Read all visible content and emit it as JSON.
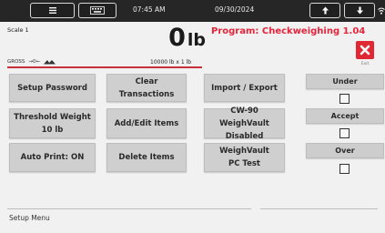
{
  "topbar": {
    "time": "07:45 AM",
    "date": "09/30/2024",
    "icons": [
      "menu-icon",
      "keyboard-icon",
      "arrow-up-icon",
      "arrow-down-icon",
      "wifi-icon"
    ]
  },
  "display": {
    "scale_name": "Scale 1",
    "weight_value": "0",
    "weight_unit": "lb",
    "gross_label": "GROSS",
    "zero_indicator": "→0←",
    "capacity": "10000 lb x 1 lb"
  },
  "program": {
    "title": "Program: Checkweighing 1.04",
    "exit_label": "Exit"
  },
  "buttons": {
    "setup_password": "Setup Password",
    "clear_transactions": "Clear Transactions",
    "import_export": "Import / Export",
    "threshold_weight_line1": "Threshold Weight",
    "threshold_weight_line2": "10 lb",
    "add_edit_items": "Add/Edit Items",
    "weighvault_line1": "CW-90 WeighVault",
    "weighvault_line2": "Disabled",
    "auto_print": "Auto Print: ON",
    "delete_items": "Delete Items",
    "pc_test_line1": "WeighVault",
    "pc_test_line2": "PC Test"
  },
  "options": {
    "under": "Under",
    "accept": "Accept",
    "over": "Over"
  },
  "footer": {
    "text": "Setup Menu"
  },
  "colors": {
    "accent_red": "#e4243a",
    "topbar": "#262626",
    "button_bg": "#cfcfcf"
  }
}
